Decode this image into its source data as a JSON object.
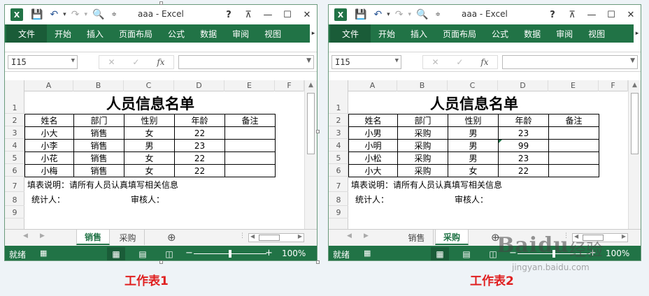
{
  "windows": [
    {
      "id": "win1",
      "title": "aaa - Excel",
      "ribbon_tabs": [
        "文件",
        "开始",
        "插入",
        "页面布局",
        "公式",
        "数据",
        "审阅",
        "视图"
      ],
      "name_box": "I15",
      "columns": [
        "A",
        "B",
        "C",
        "D",
        "E",
        "F"
      ],
      "rows": [
        "1",
        "2",
        "3",
        "4",
        "5",
        "6",
        "7",
        "8",
        "9"
      ],
      "sheet_title": "人员信息名单",
      "headers": [
        "姓名",
        "部门",
        "性别",
        "年龄",
        "备注"
      ],
      "table": [
        [
          "小大",
          "销售",
          "女",
          "22",
          ""
        ],
        [
          "小李",
          "销售",
          "男",
          "23",
          ""
        ],
        [
          "小花",
          "销售",
          "女",
          "22",
          ""
        ],
        [
          "小梅",
          "销售",
          "女",
          "22",
          ""
        ]
      ],
      "note": "填表说明：请所有人员认真填写相关信息",
      "stat_label": "统计人：",
      "review_label": "审核人：",
      "tabs": [
        {
          "label": "销售",
          "active": true
        },
        {
          "label": "采购",
          "active": false
        }
      ],
      "status_text": "就绪",
      "zoom": "100%",
      "zoom_level": 0.5
    },
    {
      "id": "win2",
      "title": "aaa - Excel",
      "ribbon_tabs": [
        "文件",
        "开始",
        "插入",
        "页面布局",
        "公式",
        "数据",
        "审阅",
        "视图"
      ],
      "name_box": "I15",
      "columns": [
        "A",
        "B",
        "C",
        "D",
        "E",
        "F"
      ],
      "rows": [
        "1",
        "2",
        "3",
        "4",
        "5",
        "6",
        "7",
        "8",
        "9"
      ],
      "sheet_title": "人员信息名单",
      "headers": [
        "姓名",
        "部门",
        "性别",
        "年龄",
        "备注"
      ],
      "table": [
        [
          "小男",
          "采购",
          "男",
          "23",
          ""
        ],
        [
          "小明",
          "采购",
          "男",
          "99",
          ""
        ],
        [
          "小松",
          "采购",
          "男",
          "23",
          ""
        ],
        [
          "小大",
          "采购",
          "女",
          "22",
          ""
        ]
      ],
      "note": "填表说明：请所有人员认真填写相关信息",
      "stat_label": "统计人：",
      "review_label": "审核人：",
      "tabs": [
        {
          "label": "销售",
          "active": false
        },
        {
          "label": "采购",
          "active": true
        }
      ],
      "status_text": "就绪",
      "zoom": "100%",
      "zoom_level": 0.5
    }
  ],
  "labels": [
    "工作表1",
    "工作表2"
  ],
  "watermark": {
    "brand": "Baidu",
    "suffix": "经验",
    "url": "jingyan.baidu.com"
  },
  "colors": {
    "excel_green": "#217346",
    "label_red": "#e02020"
  }
}
